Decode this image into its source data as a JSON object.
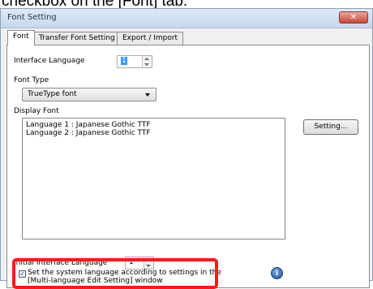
{
  "caption": "checkbox on the [Font] tab.",
  "window": {
    "title": "Font Setting",
    "close_glyph": "✕"
  },
  "tabs": [
    {
      "label": "Font"
    },
    {
      "label": "Transfer Font Setting"
    },
    {
      "label": "Export / Import"
    }
  ],
  "font_tab": {
    "interface_language_label": "Interface Language",
    "interface_language_value": "1",
    "font_type_label": "Font Type",
    "font_type_value": "TrueType font",
    "display_font_label": "Display Font",
    "display_fonts": [
      "Language 1 : Japanese Gothic TTF",
      "Language 2 : Japanese Gothic TTF"
    ],
    "setting_button": "Setting...",
    "initial_interface_language_label": "Initial Interface Language",
    "initial_interface_language_value": "1",
    "system_language_checkbox_line1": "Set the system language according to settings in the",
    "system_language_checkbox_line2": "[Multi-language Edit Setting] window",
    "system_language_checked": true
  },
  "icons": {
    "close": "close-icon",
    "info": "info-icon",
    "spin_up": "chevron-up-icon",
    "spin_down": "chevron-down-icon",
    "dropdown": "chevron-down-icon"
  },
  "colors": {
    "highlight": "#ff1a1a",
    "selection": "#3399ff"
  }
}
